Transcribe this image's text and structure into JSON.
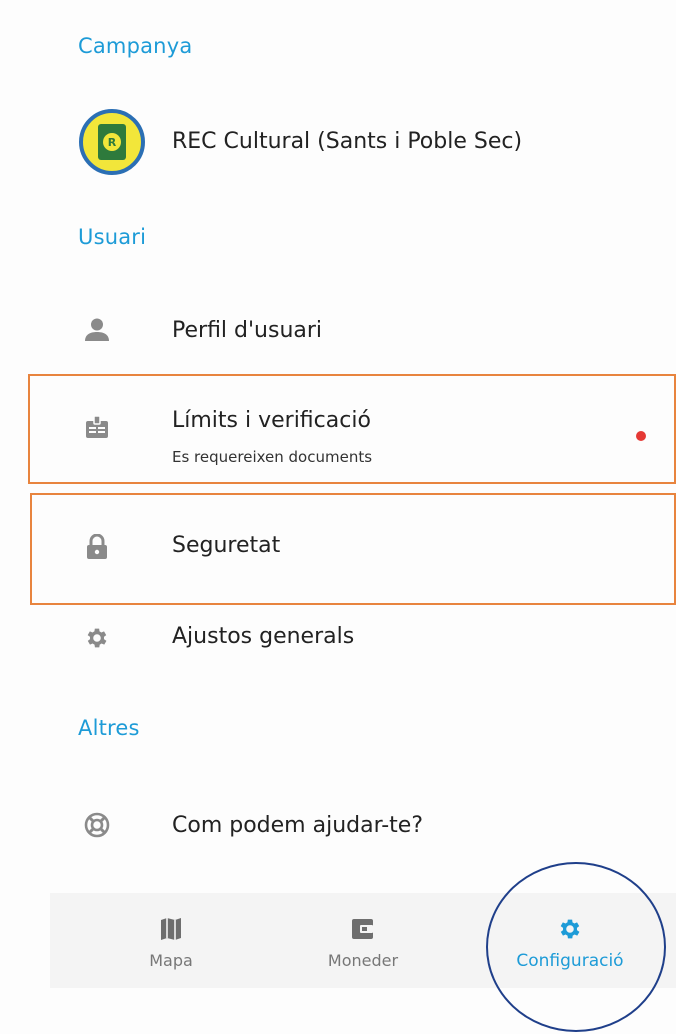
{
  "sections": {
    "campaign": "Campanya",
    "user": "Usuari",
    "others": "Altres"
  },
  "campaign_item": {
    "title": "REC Cultural (Sants i Poble Sec)",
    "logo_letter": "R"
  },
  "user_items": [
    {
      "title": "Perfil d'usuari",
      "icon": "person-icon"
    },
    {
      "title": "Límits i verificació",
      "subtitle": "Es requereixen documents",
      "icon": "id-badge-icon",
      "alert": true
    },
    {
      "title": "Seguretat",
      "icon": "lock-icon"
    },
    {
      "title": "Ajustos generals",
      "icon": "gear-icon"
    }
  ],
  "other_items": [
    {
      "title": "Com podem ajudar-te?",
      "icon": "lifebuoy-icon"
    }
  ],
  "bottom_nav": [
    {
      "label": "Mapa",
      "icon": "map-icon",
      "active": false
    },
    {
      "label": "Moneder",
      "icon": "wallet-icon",
      "active": false
    },
    {
      "label": "Configuració",
      "icon": "gear-icon",
      "active": true
    }
  ],
  "colors": {
    "accent": "#1d9bd7",
    "highlight": "#e8843e",
    "alert": "#e53935",
    "annotation": "#1f3f8a"
  }
}
